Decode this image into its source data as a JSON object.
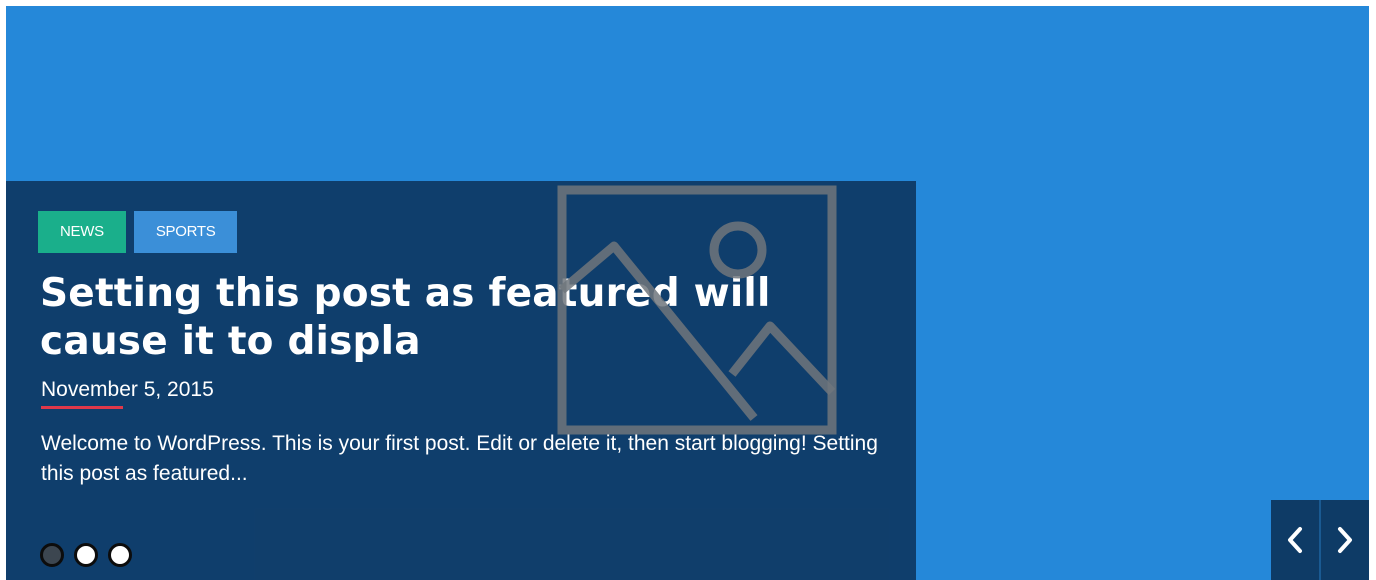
{
  "slide": {
    "tags": [
      "NEWS",
      "SPORTS"
    ],
    "title": "Setting this post as featured will cause it to displa",
    "date": "November 5, 2015",
    "excerpt": "Welcome to WordPress. This is your first post. Edit or delete it, then start blogging! Setting this post as featured..."
  },
  "pager": {
    "count": 3,
    "active_index": 0
  },
  "icons": {
    "image": "image-placeholder-icon",
    "prev": "chevron-left-icon",
    "next": "chevron-right-icon"
  },
  "colors": {
    "slide_background": "#2588d9",
    "caption_panel": "#0e3863",
    "tag_news": "#1aaf8b",
    "tag_sports": "#3b8fd8",
    "date_underline": "#e0384a",
    "nav_button": "#0e3b66"
  }
}
